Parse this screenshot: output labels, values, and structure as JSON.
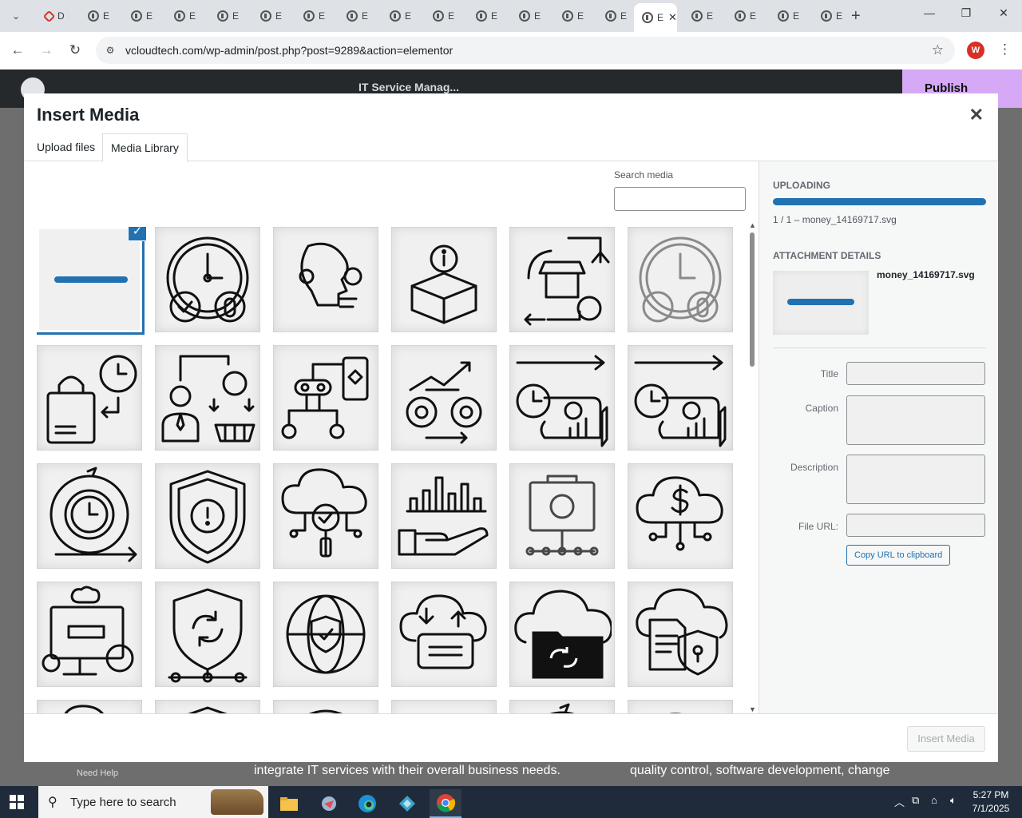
{
  "browser": {
    "tabs": [
      {
        "label": "D",
        "icon": "elementor-diamond-icon"
      },
      {
        "label": "E",
        "icon": "globe-icon"
      },
      {
        "label": "E",
        "icon": "globe-icon"
      },
      {
        "label": "E",
        "icon": "globe-icon"
      },
      {
        "label": "E",
        "icon": "globe-icon"
      },
      {
        "label": "E",
        "icon": "globe-icon"
      },
      {
        "label": "E",
        "icon": "globe-icon"
      },
      {
        "label": "E",
        "icon": "globe-icon"
      },
      {
        "label": "E",
        "icon": "globe-icon"
      },
      {
        "label": "E",
        "icon": "globe-icon"
      },
      {
        "label": "E",
        "icon": "globe-icon"
      },
      {
        "label": "E",
        "icon": "globe-icon"
      },
      {
        "label": "E",
        "icon": "globe-icon"
      },
      {
        "label": "E",
        "icon": "globe-icon"
      },
      {
        "label": "E",
        "icon": "globe-icon",
        "active": true
      },
      {
        "label": "E",
        "icon": "globe-icon"
      },
      {
        "label": "E",
        "icon": "globe-icon"
      },
      {
        "label": "E",
        "icon": "globe-icon"
      },
      {
        "label": "E",
        "icon": "globe-icon"
      }
    ],
    "url": "vcloudtech.com/wp-admin/post.php?post=9289&action=elementor",
    "profile_initial": "W"
  },
  "elementor": {
    "document_title": "IT Service Manag...",
    "publish_label": "Publish",
    "bg_text_left": "integrate IT services with their overall business needs.",
    "bg_text_right": "quality control, software development, change",
    "need_help": "Need Help"
  },
  "modal": {
    "title": "Insert Media",
    "tabs": {
      "upload": "Upload files",
      "library": "Media Library"
    },
    "search_label": "Search media",
    "search_value": "",
    "insert_button": "Insert Media"
  },
  "sidebar": {
    "uploading_heading": "UPLOADING",
    "upload_progress_percent": 100,
    "upload_status": "1 / 1 –  money_14169717.svg",
    "details_heading": "ATTACHMENT DETAILS",
    "file_name": "money_14169717.svg",
    "fields": {
      "title": "Title",
      "caption": "Caption",
      "description": "Description",
      "file_url": "File URL:"
    },
    "copy_url_button": "Copy URL to clipboard"
  },
  "media_items": [
    "selected-upload-bar",
    "gauge-health-icon",
    "ai-head-gear-icon",
    "box-info-icon",
    "shop-cycle-icon",
    "gauge-health-faded-icon",
    "shopping-bag-clock-icon",
    "businessman-basket-icon",
    "robot-mobile-icon",
    "gears-growth-icon",
    "plan-chart-clock-icon",
    "plan-chart-clock-icon",
    "time-gear-cycle-icon",
    "shield-gear-alert-icon",
    "cloud-search-icon",
    "hand-bar-chart-icon",
    "folder-bug-network-icon",
    "cloud-dollar-icon",
    "computer-cloud-gear-icon",
    "shield-sync-icon",
    "globe-shield-icon",
    "cloud-upload-download-icon",
    "cloud-folder-sync-icon",
    "cloud-document-lock-icon"
  ],
  "taskbar": {
    "search_placeholder": "Type here to search",
    "time": "5:27 PM",
    "date": "7/1/2025"
  },
  "colors": {
    "accent": "#2271b1",
    "elementor_dark": "#26292c",
    "publish": "#d5a9f5"
  }
}
